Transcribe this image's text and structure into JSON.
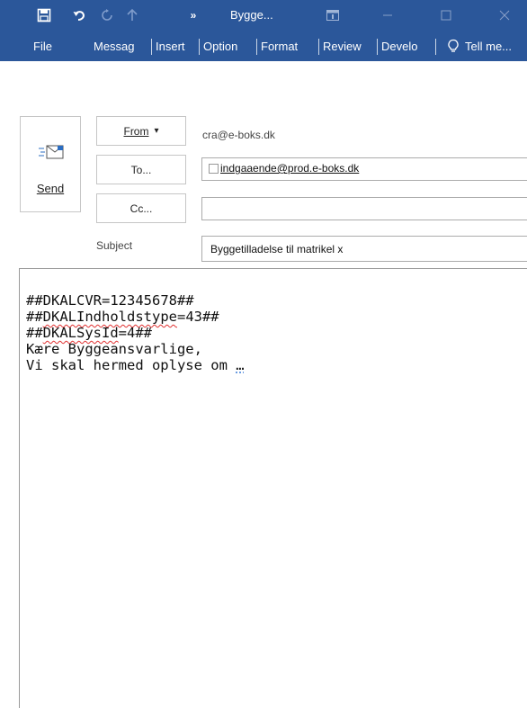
{
  "titlebar": {
    "title": "Bygge...",
    "qat": {
      "save_icon": "save-icon",
      "undo_icon": "undo-icon",
      "redo_icon": "redo-icon",
      "up_icon": "up-arrow-icon",
      "more_icon": "more-icon",
      "more_label": "»"
    },
    "window_controls": {
      "ribbon_display_icon": "ribbon-display-icon",
      "minimize_icon": "minimize-icon",
      "maximize_icon": "maximize-icon",
      "close_icon": "close-icon"
    },
    "background_color": "#2b579a"
  },
  "ribbon": {
    "tabs": [
      {
        "label": "File"
      },
      {
        "label": "Messag"
      },
      {
        "label": "Insert"
      },
      {
        "label": "Option"
      },
      {
        "label": "Format"
      },
      {
        "label": "Review"
      },
      {
        "label": "Develo"
      }
    ],
    "tell_me": {
      "icon": "lightbulb-icon",
      "label": "Tell me..."
    }
  },
  "compose": {
    "send": {
      "label": "Send",
      "icon": "send-icon"
    },
    "from": {
      "label": "From",
      "arrow": "▾",
      "address": "cra@e-boks.dk"
    },
    "to": {
      "label": "To...",
      "recipient": "indgaaende@prod.e-boks.dk"
    },
    "cc": {
      "label": "Cc...",
      "value": ""
    },
    "subject": {
      "label": "Subject",
      "value": "Byggetilladelse til matrikel x"
    }
  },
  "body": {
    "lines": [
      {
        "prefix": "##",
        "word": "DKALCVR=12345678##",
        "suffix": ""
      },
      {
        "prefix": "##",
        "word": "DKALIndholdstype",
        "suffix": "=43##"
      },
      {
        "prefix": "##",
        "word": "DKALSysId",
        "suffix": "=4##"
      },
      {
        "prefix": "",
        "word": "Kære Byggeansvarlige,",
        "suffix": ""
      },
      {
        "prefix": "",
        "word": "Vi skal hermed oplyse om ",
        "suffix": "…"
      }
    ]
  }
}
